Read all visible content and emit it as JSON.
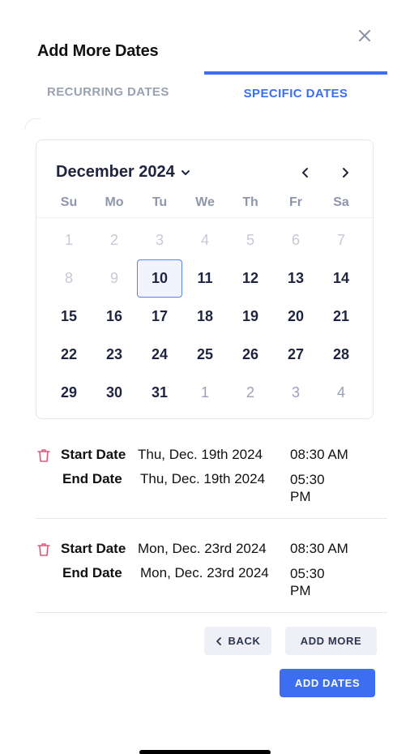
{
  "dialog": {
    "title": "Add More Dates"
  },
  "tabs": [
    {
      "label": "RECURRING DATES",
      "active": false
    },
    {
      "label": "SPECIFIC DATES",
      "active": true
    }
  ],
  "calendar": {
    "month_label": "December 2024",
    "weekdays": [
      "Su",
      "Mo",
      "Tu",
      "We",
      "Th",
      "Fr",
      "Sa"
    ],
    "weeks": [
      [
        "1",
        "2",
        "3",
        "4",
        "5",
        "6",
        "7"
      ],
      [
        "8",
        "9",
        "10",
        "11",
        "12",
        "13",
        "14"
      ],
      [
        "15",
        "16",
        "17",
        "18",
        "19",
        "20",
        "21"
      ],
      [
        "22",
        "23",
        "24",
        "25",
        "26",
        "27",
        "28"
      ],
      [
        "29",
        "30",
        "31",
        "1",
        "2",
        "3",
        "4"
      ]
    ],
    "selected_day": "10"
  },
  "entries": [
    {
      "start_label": "Start Date",
      "start_date": "Thu, Dec. 19th 2024",
      "start_time": "08:30 AM",
      "end_label": "End Date",
      "end_date": "Thu, Dec. 19th 2024",
      "end_time": "05:30 PM"
    },
    {
      "start_label": "Start Date",
      "start_date": "Mon, Dec. 23rd 2024",
      "start_time": "08:30 AM",
      "end_label": "End Date",
      "end_date": "Mon, Dec. 23rd 2024",
      "end_time": "05:30 PM"
    }
  ],
  "buttons": {
    "back": "BACK",
    "add_more": "ADD MORE",
    "add_dates": "ADD DATES"
  },
  "colors": {
    "accent": "#3d6df0",
    "delete_icon": "#e0567a"
  },
  "icons": {
    "close": "close-icon",
    "dropdown": "chevron-down-icon",
    "prev": "chevron-left-icon",
    "next": "chevron-right-icon",
    "delete": "trash-icon"
  }
}
